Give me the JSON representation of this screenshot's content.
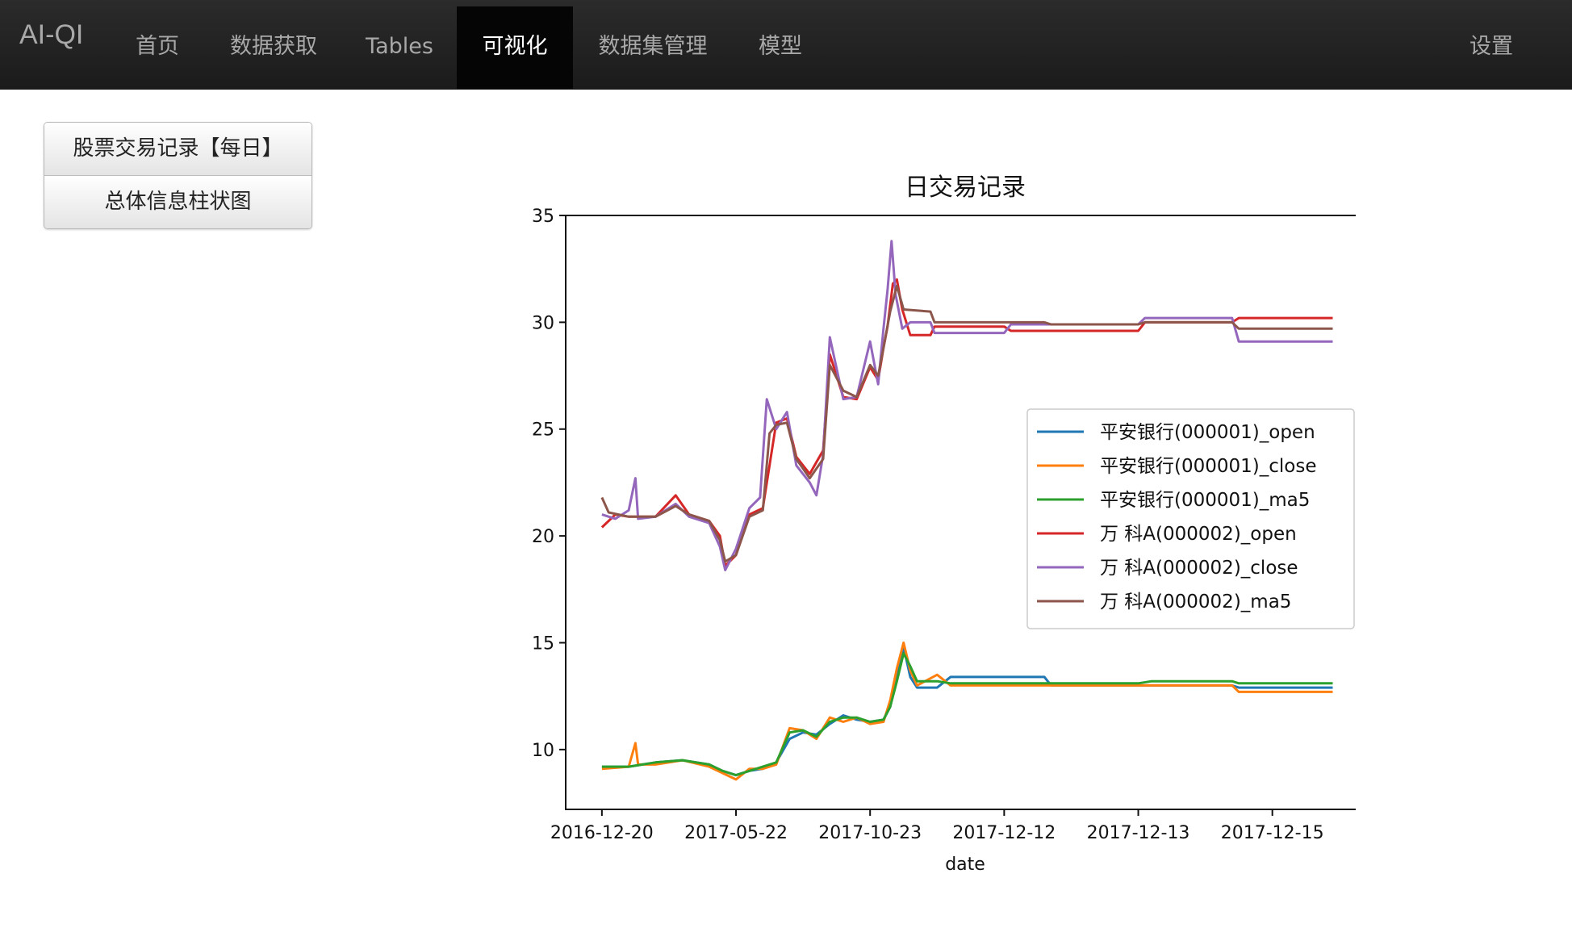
{
  "navbar": {
    "brand": "AI-QI",
    "items": [
      {
        "label": "首页"
      },
      {
        "label": "数据获取"
      },
      {
        "label": "Tables"
      },
      {
        "label": "可视化"
      },
      {
        "label": "数据集管理"
      },
      {
        "label": "模型"
      }
    ],
    "active_index": 3,
    "settings_label": "设置"
  },
  "sidebar": {
    "buttons": [
      {
        "label": "股票交易记录【每日】"
      },
      {
        "label": "总体信息柱状图"
      }
    ]
  },
  "chart_data": {
    "type": "line",
    "title": "日交易记录",
    "xlabel": "date",
    "ylabel": "",
    "ylim": [
      7.2,
      35
    ],
    "yticks": [
      10,
      15,
      20,
      25,
      30,
      35
    ],
    "xtick_labels": [
      "2016-12-20",
      "2017-05-22",
      "2017-10-23",
      "2017-12-12",
      "2017-12-13",
      "2017-12-15"
    ],
    "xtick_index": [
      0,
      100,
      200,
      300,
      400,
      500
    ],
    "xlim": [
      -27,
      570
    ],
    "legend_position": "center-right",
    "grid": false,
    "series": [
      {
        "name": "平安银行(000001)_open",
        "color": "#1f77b4",
        "points": [
          [
            0,
            9.2
          ],
          [
            20,
            9.2
          ],
          [
            40,
            9.4
          ],
          [
            60,
            9.5
          ],
          [
            80,
            9.3
          ],
          [
            90,
            9.0
          ],
          [
            100,
            8.8
          ],
          [
            110,
            9.0
          ],
          [
            120,
            9.1
          ],
          [
            130,
            9.4
          ],
          [
            140,
            10.5
          ],
          [
            150,
            10.8
          ],
          [
            160,
            10.7
          ],
          [
            170,
            11.2
          ],
          [
            180,
            11.6
          ],
          [
            190,
            11.4
          ],
          [
            200,
            11.3
          ],
          [
            210,
            11.4
          ],
          [
            215,
            12.0
          ],
          [
            220,
            13.5
          ],
          [
            225,
            14.8
          ],
          [
            230,
            13.4
          ],
          [
            235,
            12.9
          ],
          [
            250,
            12.9
          ],
          [
            260,
            13.4
          ],
          [
            330,
            13.4
          ],
          [
            335,
            13.0
          ],
          [
            400,
            13.0
          ],
          [
            410,
            13.0
          ],
          [
            470,
            13.0
          ],
          [
            475,
            12.9
          ],
          [
            545,
            12.9
          ]
        ]
      },
      {
        "name": "平安银行(000001)_close",
        "color": "#ff7f0e",
        "points": [
          [
            0,
            9.1
          ],
          [
            20,
            9.2
          ],
          [
            25,
            10.3
          ],
          [
            27,
            9.3
          ],
          [
            40,
            9.3
          ],
          [
            60,
            9.5
          ],
          [
            80,
            9.2
          ],
          [
            90,
            8.9
          ],
          [
            100,
            8.6
          ],
          [
            110,
            9.1
          ],
          [
            120,
            9.1
          ],
          [
            130,
            9.3
          ],
          [
            140,
            11.0
          ],
          [
            150,
            10.9
          ],
          [
            160,
            10.5
          ],
          [
            170,
            11.5
          ],
          [
            180,
            11.3
          ],
          [
            190,
            11.5
          ],
          [
            200,
            11.2
          ],
          [
            210,
            11.3
          ],
          [
            215,
            12.3
          ],
          [
            220,
            13.8
          ],
          [
            225,
            15.0
          ],
          [
            230,
            13.7
          ],
          [
            235,
            13.0
          ],
          [
            250,
            13.5
          ],
          [
            260,
            13.0
          ],
          [
            330,
            13.0
          ],
          [
            335,
            13.0
          ],
          [
            400,
            13.0
          ],
          [
            410,
            13.0
          ],
          [
            470,
            13.0
          ],
          [
            475,
            12.7
          ],
          [
            545,
            12.7
          ]
        ]
      },
      {
        "name": "平安银行(000001)_ma5",
        "color": "#2ca02c",
        "points": [
          [
            0,
            9.2
          ],
          [
            20,
            9.2
          ],
          [
            40,
            9.4
          ],
          [
            60,
            9.5
          ],
          [
            80,
            9.3
          ],
          [
            90,
            9.0
          ],
          [
            100,
            8.8
          ],
          [
            110,
            9.0
          ],
          [
            120,
            9.2
          ],
          [
            130,
            9.4
          ],
          [
            140,
            10.8
          ],
          [
            150,
            10.9
          ],
          [
            160,
            10.6
          ],
          [
            170,
            11.3
          ],
          [
            180,
            11.5
          ],
          [
            190,
            11.5
          ],
          [
            200,
            11.3
          ],
          [
            210,
            11.4
          ],
          [
            215,
            12.0
          ],
          [
            220,
            13.2
          ],
          [
            225,
            14.5
          ],
          [
            230,
            13.9
          ],
          [
            235,
            13.2
          ],
          [
            250,
            13.2
          ],
          [
            260,
            13.1
          ],
          [
            330,
            13.1
          ],
          [
            335,
            13.1
          ],
          [
            400,
            13.1
          ],
          [
            410,
            13.2
          ],
          [
            470,
            13.2
          ],
          [
            475,
            13.1
          ],
          [
            545,
            13.1
          ]
        ]
      },
      {
        "name": "万 科A(000002)_open",
        "color": "#d62728",
        "points": [
          [
            0,
            20.4
          ],
          [
            10,
            21.0
          ],
          [
            20,
            20.9
          ],
          [
            40,
            20.9
          ],
          [
            55,
            21.9
          ],
          [
            65,
            21.0
          ],
          [
            80,
            20.7
          ],
          [
            88,
            20.0
          ],
          [
            92,
            18.6
          ],
          [
            100,
            19.1
          ],
          [
            110,
            21.0
          ],
          [
            120,
            21.3
          ],
          [
            130,
            25.3
          ],
          [
            138,
            25.5
          ],
          [
            145,
            23.7
          ],
          [
            155,
            22.9
          ],
          [
            165,
            24.0
          ],
          [
            170,
            28.5
          ],
          [
            180,
            26.5
          ],
          [
            190,
            26.4
          ],
          [
            200,
            27.9
          ],
          [
            206,
            27.3
          ],
          [
            210,
            28.8
          ],
          [
            213,
            29.8
          ],
          [
            217,
            31.8
          ],
          [
            220,
            32.0
          ],
          [
            224,
            30.6
          ],
          [
            230,
            29.4
          ],
          [
            245,
            29.4
          ],
          [
            248,
            29.8
          ],
          [
            300,
            29.8
          ],
          [
            305,
            29.6
          ],
          [
            400,
            29.6
          ],
          [
            405,
            30.0
          ],
          [
            470,
            30.0
          ],
          [
            475,
            30.2
          ],
          [
            545,
            30.2
          ]
        ]
      },
      {
        "name": "万 科A(000002)_close",
        "color": "#9467bd",
        "points": [
          [
            0,
            21.0
          ],
          [
            10,
            20.8
          ],
          [
            20,
            21.2
          ],
          [
            25,
            22.7
          ],
          [
            27,
            20.8
          ],
          [
            40,
            20.9
          ],
          [
            55,
            21.5
          ],
          [
            65,
            20.9
          ],
          [
            80,
            20.6
          ],
          [
            88,
            19.5
          ],
          [
            92,
            18.4
          ],
          [
            100,
            19.4
          ],
          [
            110,
            21.3
          ],
          [
            118,
            21.8
          ],
          [
            123,
            26.4
          ],
          [
            130,
            25.0
          ],
          [
            138,
            25.8
          ],
          [
            145,
            23.3
          ],
          [
            155,
            22.5
          ],
          [
            160,
            21.9
          ],
          [
            165,
            23.8
          ],
          [
            170,
            29.3
          ],
          [
            180,
            26.4
          ],
          [
            190,
            26.5
          ],
          [
            200,
            29.1
          ],
          [
            206,
            27.1
          ],
          [
            210,
            29.7
          ],
          [
            213,
            31.5
          ],
          [
            216,
            33.8
          ],
          [
            219,
            31.3
          ],
          [
            224,
            29.7
          ],
          [
            230,
            30.0
          ],
          [
            245,
            30.0
          ],
          [
            248,
            29.5
          ],
          [
            300,
            29.5
          ],
          [
            305,
            29.9
          ],
          [
            400,
            29.9
          ],
          [
            405,
            30.2
          ],
          [
            470,
            30.2
          ],
          [
            475,
            29.1
          ],
          [
            545,
            29.1
          ]
        ]
      },
      {
        "name": "万 科A(000002)_ma5",
        "color": "#8c564b",
        "points": [
          [
            0,
            21.8
          ],
          [
            5,
            21.1
          ],
          [
            20,
            20.9
          ],
          [
            40,
            20.9
          ],
          [
            55,
            21.4
          ],
          [
            65,
            21.0
          ],
          [
            80,
            20.7
          ],
          [
            88,
            19.8
          ],
          [
            92,
            18.8
          ],
          [
            100,
            19.1
          ],
          [
            110,
            20.9
          ],
          [
            120,
            21.2
          ],
          [
            125,
            24.8
          ],
          [
            130,
            25.2
          ],
          [
            138,
            25.3
          ],
          [
            145,
            23.6
          ],
          [
            155,
            22.7
          ],
          [
            165,
            23.6
          ],
          [
            170,
            28.0
          ],
          [
            180,
            26.8
          ],
          [
            190,
            26.5
          ],
          [
            200,
            28.0
          ],
          [
            206,
            27.5
          ],
          [
            210,
            28.8
          ],
          [
            215,
            30.5
          ],
          [
            220,
            31.7
          ],
          [
            225,
            30.6
          ],
          [
            245,
            30.5
          ],
          [
            248,
            30.0
          ],
          [
            330,
            30.0
          ],
          [
            335,
            29.9
          ],
          [
            400,
            29.9
          ],
          [
            405,
            30.0
          ],
          [
            470,
            30.0
          ],
          [
            475,
            29.7
          ],
          [
            545,
            29.7
          ]
        ]
      }
    ]
  }
}
